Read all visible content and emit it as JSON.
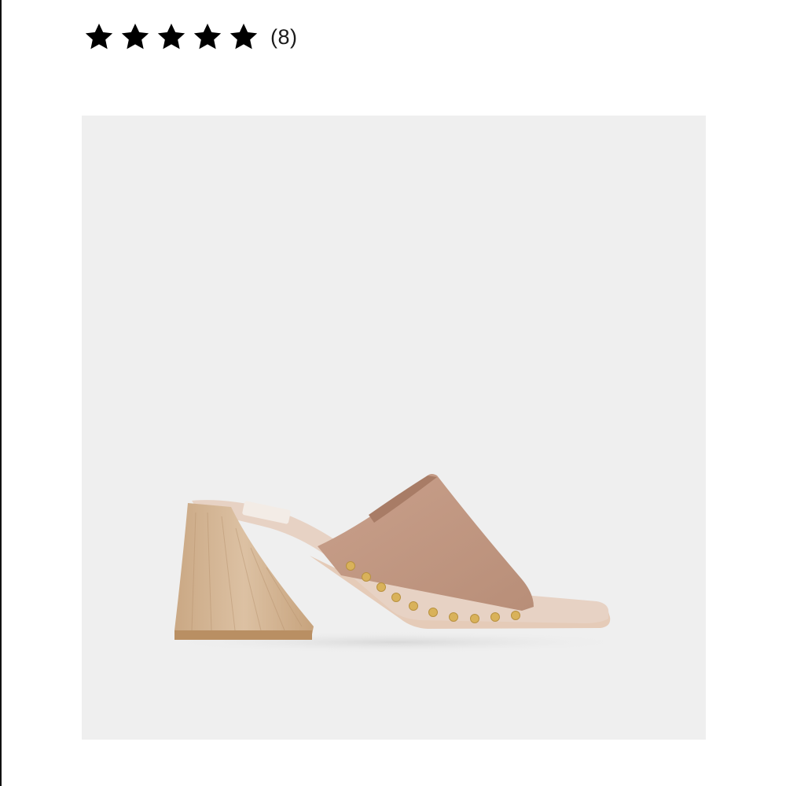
{
  "rating": {
    "value": 5,
    "max": 5,
    "review_count_text": "(8)",
    "star_color": "#000000",
    "icon": "star-icon"
  },
  "product_image": {
    "background_color": "#efefef",
    "leather_color": "#c39a85",
    "heel_color": "#d8bb9b",
    "stud_color": "#d9b25a",
    "icon": "sandal-image"
  }
}
